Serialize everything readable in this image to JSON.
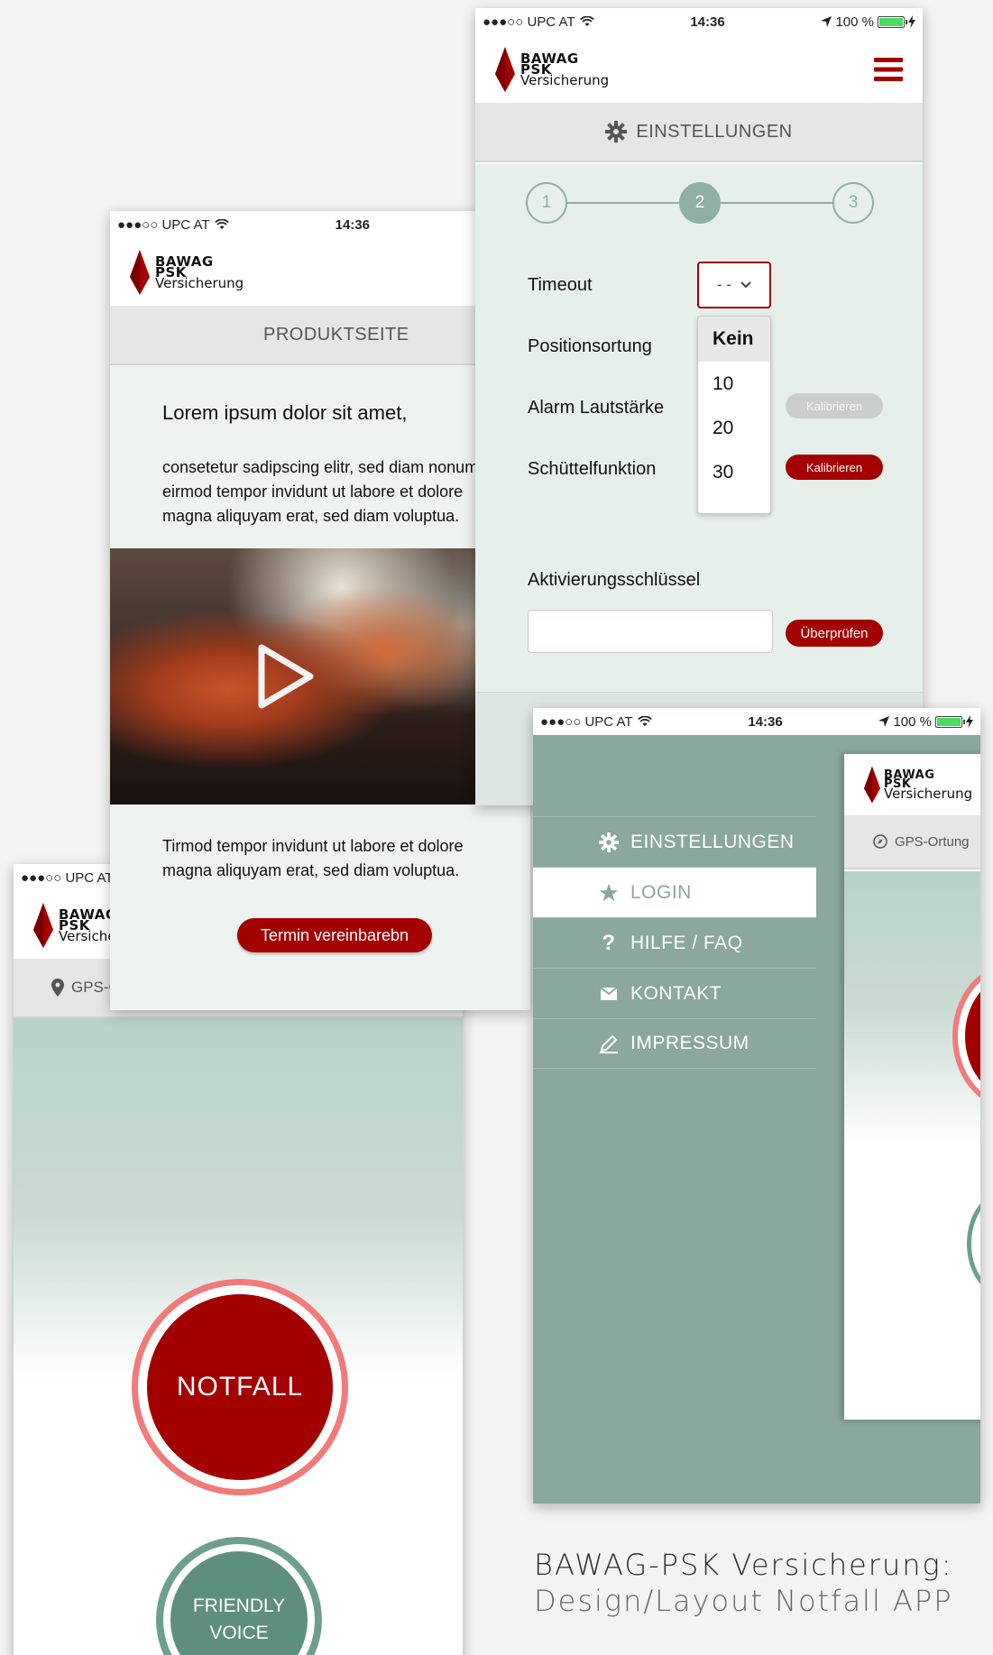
{
  "status_bar": {
    "carrier": "●●●○○ UPC AT",
    "time": "14:36",
    "battery": "100 %"
  },
  "brand": {
    "line1": "BAWAG",
    "line2": "PSK",
    "line3": "Versicherung",
    "accent": "#a30000",
    "green": "#8aa89c"
  },
  "notfall_screen": {
    "location_label": "GPS-Ortung",
    "emergency_button": "NOTFALL",
    "friendly_line1": "FRIENDLY",
    "friendly_line2": "VOICE"
  },
  "product_screen": {
    "section_title": "PRODUKTSEITE",
    "heading": "Lorem ipsum dolor sit amet,",
    "paragraph1": "consetetur sadipscing elitr, sed diam nonumy\neirmod tempor invidunt ut labore et dolore\nmagna aliquyam erat, sed diam voluptua.",
    "paragraph2": "Tirmod tempor invidunt ut labore et dolore\nmagna aliquyam erat, sed diam voluptua.",
    "cta_button": "Termin vereinbarebn"
  },
  "settings_screen": {
    "section_title": "EINSTELLUNGEN",
    "steps": [
      "1",
      "2",
      "3"
    ],
    "active_step": 2,
    "timeout_label": "Timeout",
    "timeout_value": "- -",
    "timeout_options": [
      "Kein",
      "10",
      "20",
      "30"
    ],
    "position_label": "Positionsortung",
    "alarm_label": "Alarm Lautstärke",
    "shake_label": "Schüttelfunktion",
    "calibrate_label": "Kalibrieren",
    "key_label": "Aktivierungsschlüssel",
    "key_value": "",
    "check_button": "Überprüfen"
  },
  "menu_screen": {
    "items": [
      {
        "label": "EINSTELLUNGEN",
        "icon": "gear-icon"
      },
      {
        "label": "LOGIN",
        "icon": "star-icon"
      },
      {
        "label": "HILFE / FAQ",
        "icon": "question-icon"
      },
      {
        "label": "KONTAKT",
        "icon": "mail-icon"
      },
      {
        "label": "IMPRESSUM",
        "icon": "pencil-icon"
      }
    ],
    "active_index": 1,
    "peek_location_label": "GPS-Ortung"
  },
  "caption": {
    "line1": "BAWAG-PSK Versicherung:",
    "line2": "Design/Layout Notfall APP"
  }
}
